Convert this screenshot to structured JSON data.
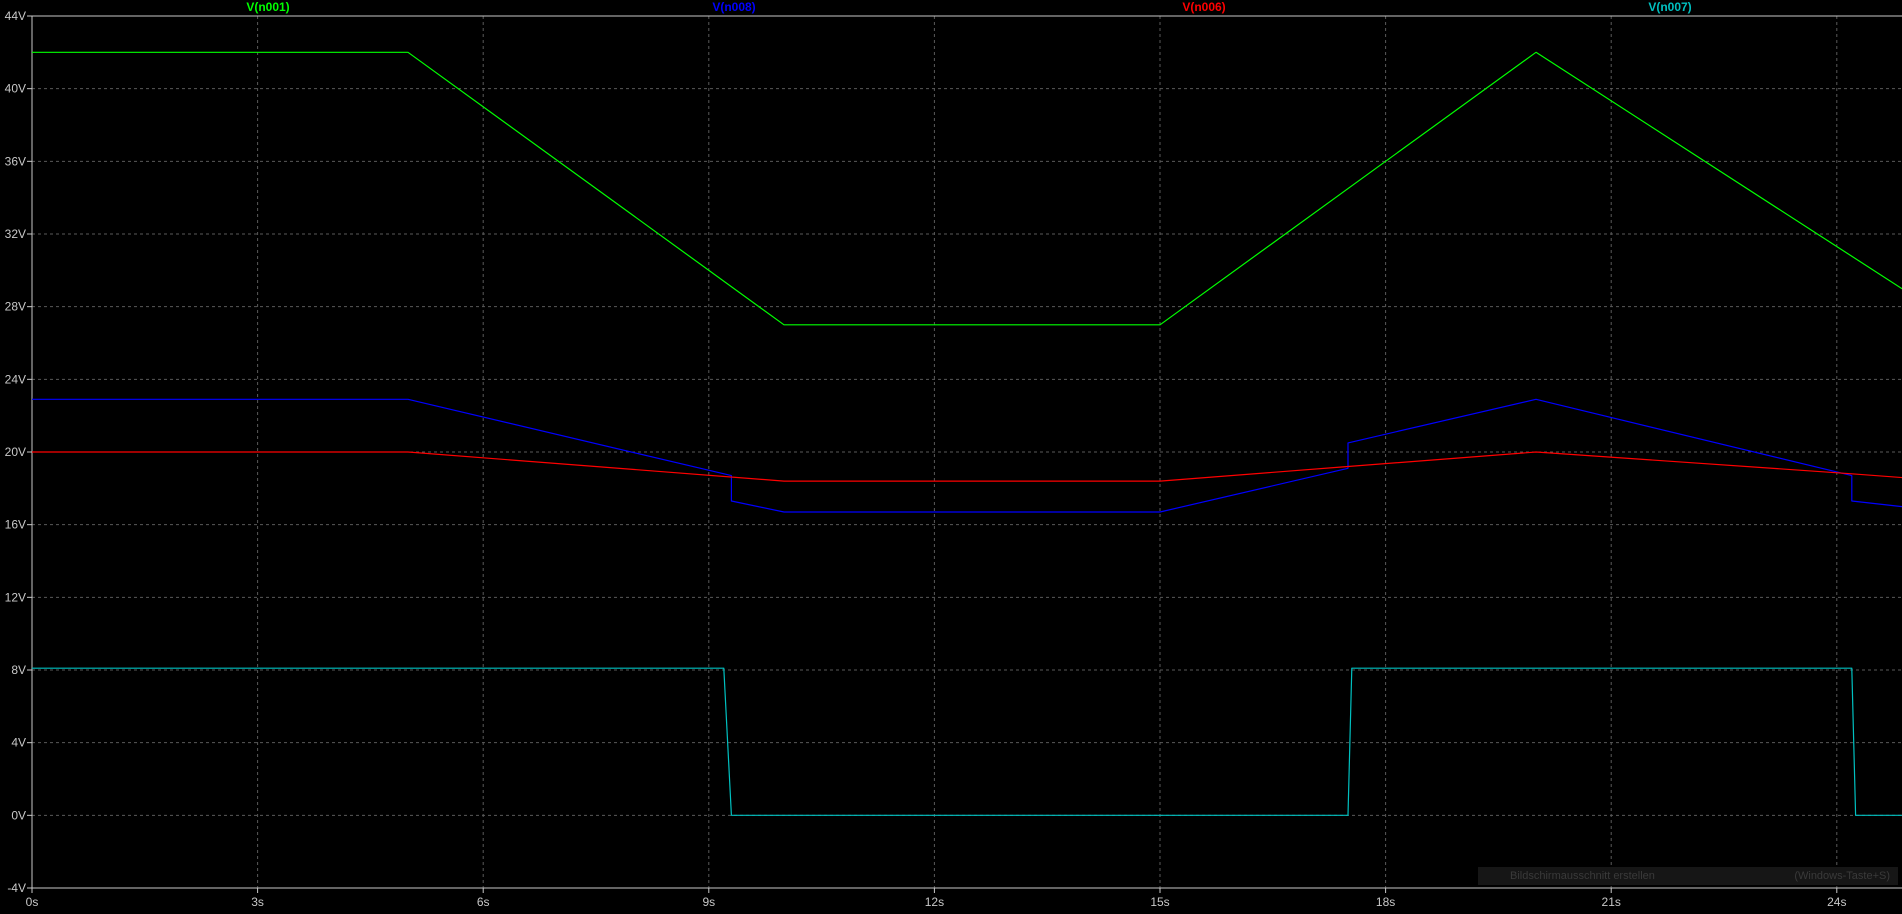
{
  "chart_data": {
    "type": "line",
    "xlabel": "",
    "ylabel": "",
    "xlim": [
      0,
      25.5
    ],
    "ylim": [
      -4,
      44
    ],
    "grid": true,
    "legend": "top",
    "x_ticks": [
      "0s",
      "3s",
      "6s",
      "9s",
      "12s",
      "15s",
      "18s",
      "21s",
      "24s"
    ],
    "y_ticks": [
      "-4V",
      "0V",
      "4V",
      "8V",
      "12V",
      "16V",
      "20V",
      "24V",
      "28V",
      "32V",
      "36V",
      "40V",
      "44V"
    ],
    "series": [
      {
        "name": "V(n001)",
        "color": "#00ff00",
        "points": [
          [
            0,
            42
          ],
          [
            5,
            42
          ],
          [
            10,
            27
          ],
          [
            15,
            27
          ],
          [
            20,
            42
          ],
          [
            25.5,
            27.3
          ]
        ]
      },
      {
        "name": "V(n008)",
        "color": "#0000ff",
        "points": [
          [
            0,
            22.9
          ],
          [
            5,
            22.9
          ],
          [
            9.3,
            18.7
          ],
          [
            9.3,
            17.3
          ],
          [
            10,
            16.7
          ],
          [
            15,
            16.7
          ],
          [
            17.5,
            19.1
          ],
          [
            17.5,
            20.5
          ],
          [
            20,
            22.9
          ],
          [
            24.2,
            18.7
          ],
          [
            24.2,
            17.3
          ],
          [
            25.5,
            16.7
          ]
        ]
      },
      {
        "name": "V(n006)",
        "color": "#ff0000",
        "points": [
          [
            0,
            20
          ],
          [
            5,
            20
          ],
          [
            10,
            18.4
          ],
          [
            15,
            18.4
          ],
          [
            17.5,
            19.2
          ],
          [
            20,
            20
          ],
          [
            24.2,
            18.8
          ],
          [
            25.5,
            18.4
          ]
        ]
      },
      {
        "name": "V(n007)",
        "color": "#00c0c0",
        "points": [
          [
            0,
            8.1
          ],
          [
            9.2,
            8.1
          ],
          [
            9.3,
            0
          ],
          [
            17.5,
            0
          ],
          [
            17.55,
            8.1
          ],
          [
            24.2,
            8.1
          ],
          [
            24.25,
            0
          ],
          [
            25.5,
            0
          ]
        ]
      }
    ]
  },
  "tooltip": {
    "left": "Bildschirmausschnitt erstellen",
    "right": "(Windows-Taste+S)"
  }
}
